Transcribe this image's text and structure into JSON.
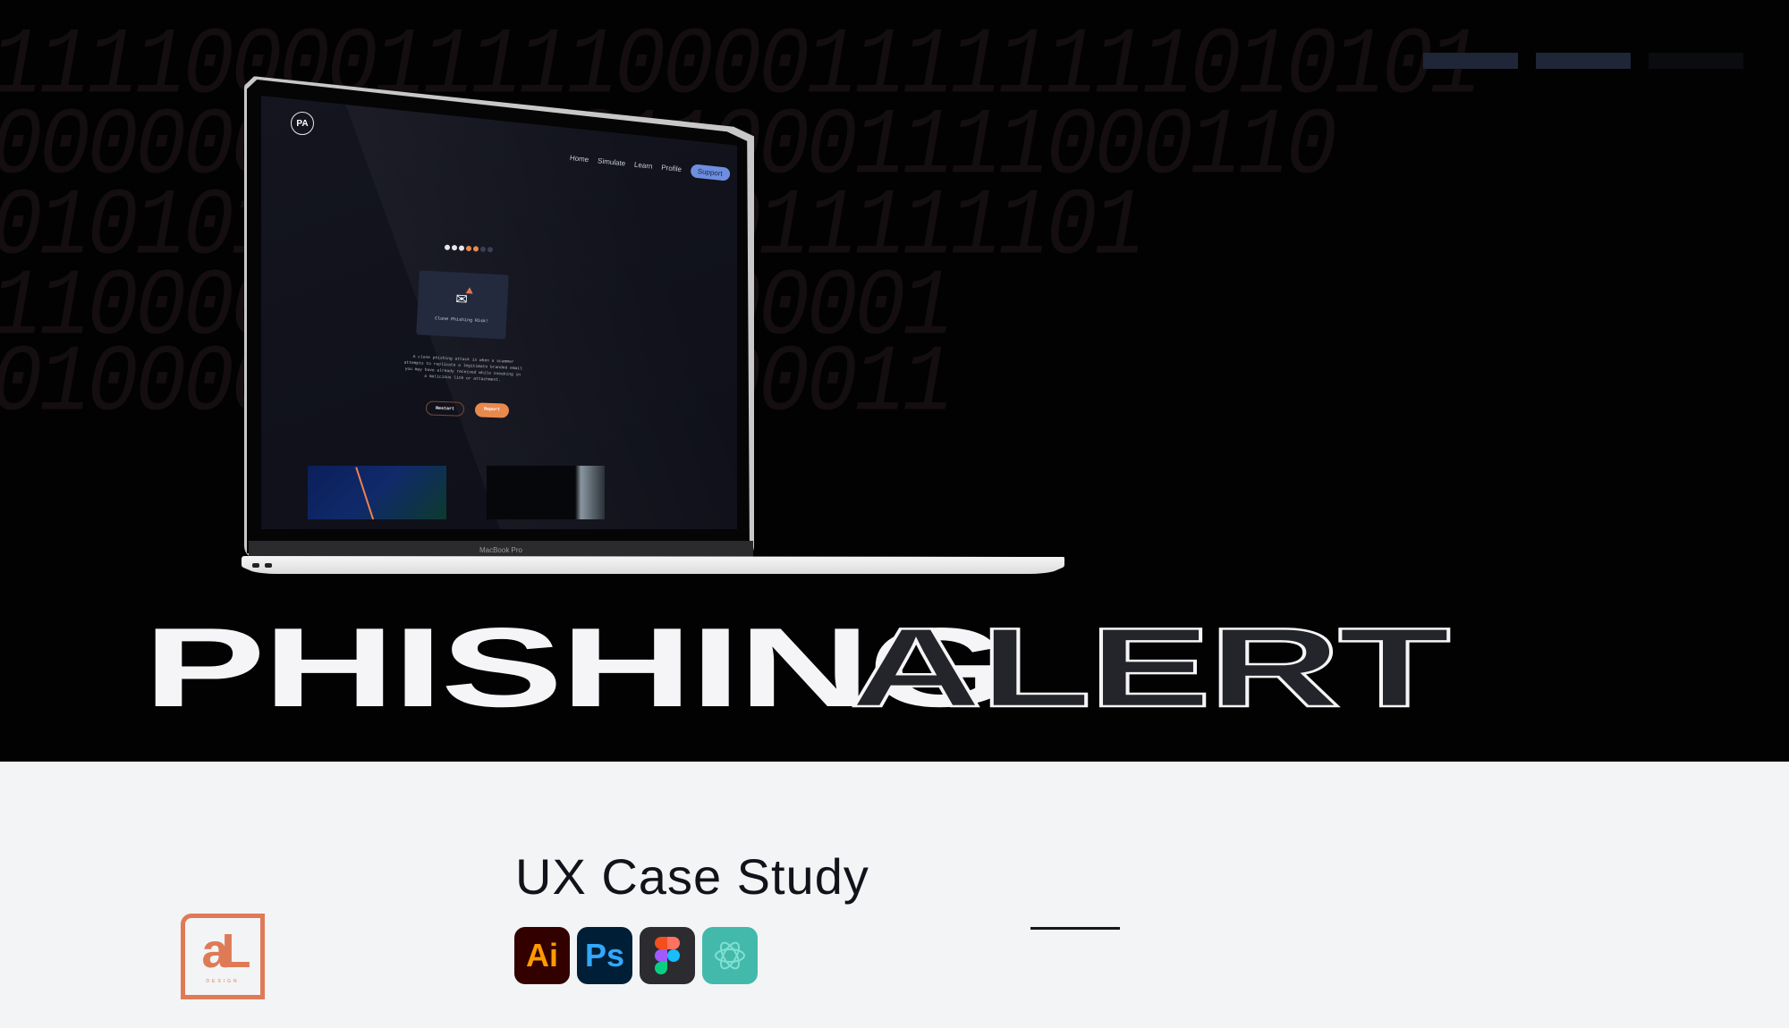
{
  "background_binary": [
    "1111000011111000011111111010101",
    "0000000001100110001111000110",
    "010101010101000011111101",
    "11000000110111100001",
    "01000001101111100011"
  ],
  "top_bars": [
    "bar",
    "bar",
    "bar-dim"
  ],
  "laptop": {
    "model_label": "MacBook Pro",
    "screen": {
      "logo_text": "PA",
      "nav": [
        "Home",
        "Simulate",
        "Learn",
        "Profile"
      ],
      "nav_cta": "Support",
      "progress_dots": {
        "total": 7,
        "completed_white": 3,
        "current_orange": 2
      },
      "card_title": "Clone Phishing Risk!",
      "description": "A clone phishing attack is when a scammer attempts to replicate a legitimate branded email you may have already received while sneaking in a malicious link or attachment.",
      "restart_label": "Restart",
      "report_label": "Report"
    }
  },
  "title": {
    "solid": "PHISHING",
    "outline": "ALERT"
  },
  "subtitle": "UX Case Study",
  "tools": [
    {
      "name": "adobe-illustrator-icon",
      "label": "Ai"
    },
    {
      "name": "adobe-photoshop-icon",
      "label": "Ps"
    },
    {
      "name": "figma-icon",
      "label": ""
    },
    {
      "name": "chatgpt-icon",
      "label": ""
    }
  ],
  "brand_logo": {
    "mark": "aL",
    "sub": "DESIGN"
  },
  "colors": {
    "accent_orange": "#e8894e",
    "support_blue": "#6e8fe0",
    "logo_orange": "#df7a56",
    "hero_bg": "#020202",
    "page_bg": "#f3f4f6"
  }
}
